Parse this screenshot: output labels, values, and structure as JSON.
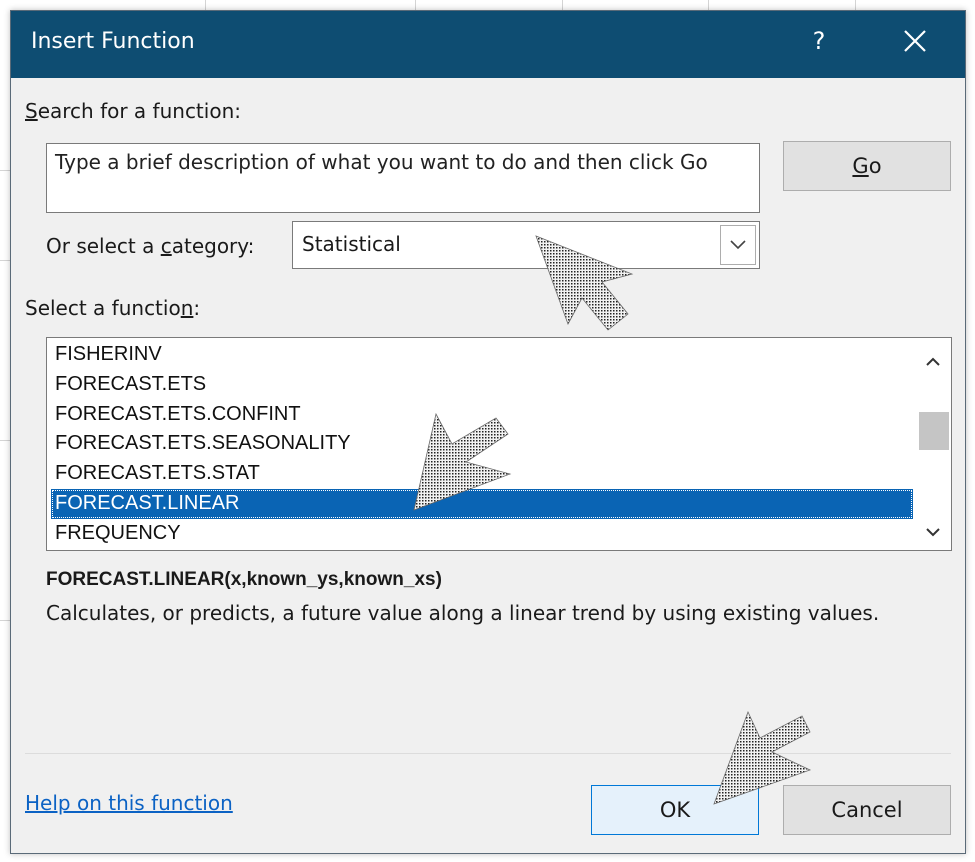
{
  "dialog": {
    "title": "Insert Function",
    "help_glyph": "?",
    "close_icon": "close-icon",
    "title_bar_color": "#0e4d72"
  },
  "search": {
    "label_underlined": "S",
    "label_rest": "earch for a function:",
    "value": "Type a brief description of what you want to do and then click Go",
    "go_underlined": "G",
    "go_rest": "o"
  },
  "category": {
    "label_before": "Or select a ",
    "label_underlined": "c",
    "label_after": "ategory:",
    "selected": "Statistical"
  },
  "functions": {
    "label_before": "Select a functio",
    "label_underlined": "n",
    "label_after": ":",
    "items": [
      "FISHERINV",
      "FORECAST.ETS",
      "FORECAST.ETS.CONFINT",
      "FORECAST.ETS.SEASONALITY",
      "FORECAST.ETS.STAT",
      "FORECAST.LINEAR",
      "FREQUENCY"
    ],
    "selected_index": 5,
    "selection_color": "#0a64b4"
  },
  "details": {
    "signature": "FORECAST.LINEAR(x,known_ys,known_xs)",
    "description": "Calculates, or predicts, a future value along a linear trend by using existing values."
  },
  "footer": {
    "help_link": "Help on this function",
    "ok_label": "OK",
    "cancel_label": "Cancel"
  }
}
